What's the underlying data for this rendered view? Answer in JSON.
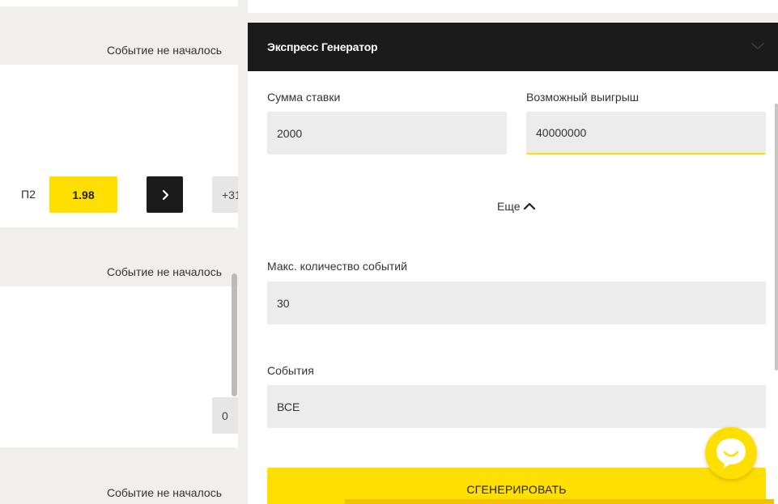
{
  "events": {
    "status_1": "Событие не началось",
    "status_2": "Событие не началось",
    "status_3": "Событие не началось",
    "odds_label": "П2",
    "odds_value": "1.98",
    "more_count_1": "+31",
    "more_count_2": "0"
  },
  "express": {
    "title": "Экспресс Генератор",
    "stake_label": "Сумма ставки",
    "stake_value": "2000",
    "win_label": "Возможный выигрыш",
    "win_value": "40000000",
    "more_label": "Еще",
    "max_events_label": "Макс. количество событий",
    "max_events_value": "30",
    "events_label": "События",
    "events_value": "ВСЕ",
    "generate_label": "СГЕНЕРИРОВАТЬ"
  },
  "colors": {
    "accent": "#ffdf00",
    "dark": "#1b1b1b",
    "field_bg": "#ececec",
    "page_bg": "#f0efec"
  }
}
